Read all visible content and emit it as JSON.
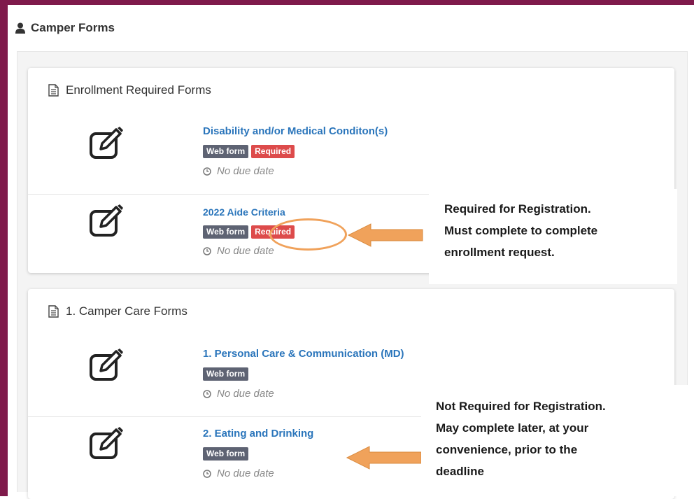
{
  "section": {
    "title": "Camper Forms",
    "icon": "user-icon"
  },
  "panels": [
    {
      "title": "Enrollment Required Forms",
      "icon": "document-icon",
      "forms": [
        {
          "title": "Disability and/or Medical Conditon(s)",
          "badges": [
            "Web form",
            "Required"
          ],
          "due": "No due date",
          "icon": "edit-icon"
        },
        {
          "title": "2022 Aide Criteria",
          "badges": [
            "Web form",
            "Required"
          ],
          "due": "No due date",
          "icon": "edit-icon"
        }
      ]
    },
    {
      "title": "1. Camper Care Forms",
      "icon": "document-icon",
      "forms": [
        {
          "title": "1. Personal Care & Communication (MD)",
          "badges": [
            "Web form"
          ],
          "due": "No due date",
          "icon": "edit-icon"
        },
        {
          "title": "2. Eating and Drinking",
          "badges": [
            "Web form"
          ],
          "due": "No due date",
          "icon": "edit-icon"
        }
      ]
    }
  ],
  "callouts": [
    {
      "lines": [
        "Required for Registration.",
        "Must complete to complete",
        "enrollment request."
      ]
    },
    {
      "lines": [
        "Not Required for Registration.",
        "May complete later, at your",
        "convenience, prior to the",
        "deadline"
      ]
    }
  ],
  "colors": {
    "frame": "#7f1a4b",
    "link": "#2a75bb",
    "badge_web": "#5e6373",
    "badge_required": "#dd4b4b",
    "annotation_orange": "#f0a25b"
  }
}
